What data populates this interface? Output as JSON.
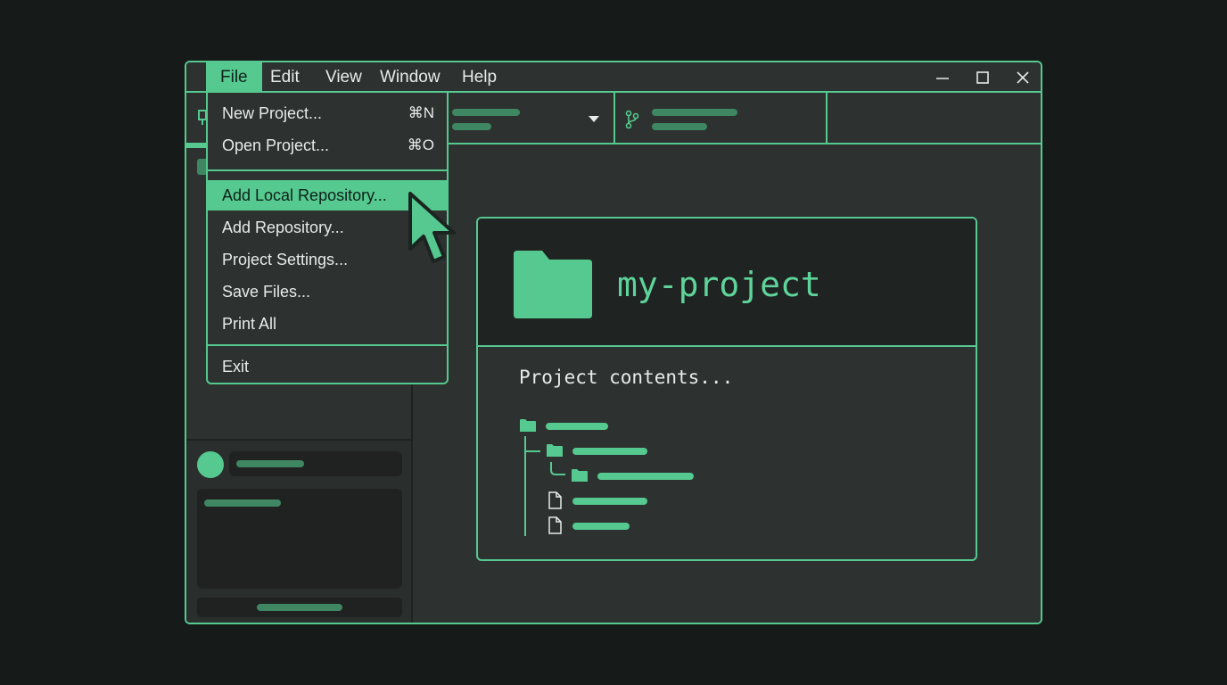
{
  "menubar": {
    "items": [
      "File",
      "Edit",
      "View",
      "Window",
      "Help"
    ],
    "active": "File"
  },
  "file_menu": {
    "items": [
      {
        "label": "New Project...",
        "shortcut": "⌘N"
      },
      {
        "label": "Open Project...",
        "shortcut": "⌘O"
      },
      {
        "label": "Add Local Repository...",
        "shortcut": ""
      },
      {
        "label": "Add Repository...",
        "shortcut": ""
      },
      {
        "label": "Project Settings...",
        "shortcut": ""
      },
      {
        "label": "Save Files...",
        "shortcut": ""
      },
      {
        "label": "Print All",
        "shortcut": ""
      },
      {
        "label": "Exit",
        "shortcut": ""
      }
    ],
    "highlighted": "Add Local Repository..."
  },
  "project": {
    "name": "my-project",
    "contents_label": "Project contents..."
  },
  "icons": {
    "folder": "folder-icon",
    "file": "file-icon",
    "branch": "git-branch-icon",
    "minimize": "minimize-icon",
    "maximize": "maximize-icon",
    "close": "close-icon",
    "cursor": "mouse-pointer-icon"
  },
  "colors": {
    "accent": "#55c98f",
    "background": "#161b19",
    "window": "#2d3130",
    "text": "#e6ece9"
  }
}
